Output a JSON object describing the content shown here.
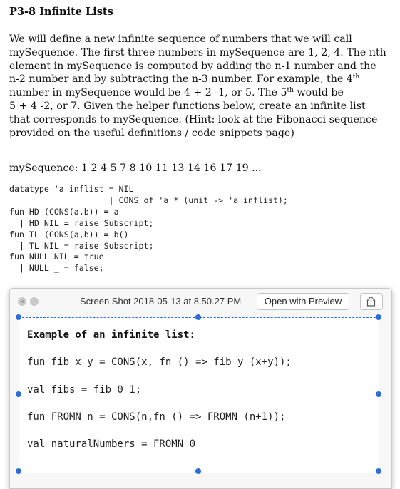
{
  "document": {
    "heading": "P3-8  Infinite Lists",
    "paragraph_lines": [
      "We will define a new infinite sequence of numbers that we will call",
      "mySequence. The first three numbers in mySequence are 1, 2, 4. The nth",
      "element in mySequence is computed by adding the n-1 number and the",
      "n-2 number and by subtracting the n-3 number.  For example, the 4",
      "number in mySequence would be 4 + 2 -1, or 5.  The 5",
      "5 + 4 -2, or 7. Given the helper functions below, create an infinite list",
      "that corresponds to mySequence. (Hint: look at the Fibonacci sequence",
      "provided on the useful definitions / code snippets page)"
    ],
    "sup_th": "th",
    "line5_tail": " would be",
    "sequence": "mySequence: 1 2 4 5 7 8 10 11 13 14 16 17 19 ...",
    "code_lines": [
      "datatype 'a inflist = NIL",
      "                    | CONS of 'a * (unit -> 'a inflist);",
      "fun HD (CONS(a,b)) = a",
      "  | HD NIL = raise Subscript;",
      "fun TL (CONS(a,b)) = b()",
      "  | TL NIL = raise Subscript;",
      "fun NULL NIL = true",
      "  | NULL _ = false;"
    ]
  },
  "popup": {
    "title": "Screen Shot 2018-05-13 at 8.50.27 PM",
    "open_button": "Open with Preview",
    "share_icon": "share-icon",
    "close_glyph": "×",
    "snippet_title": "Example of an infinite list:",
    "snippet_lines": [
      "fun fib x y = CONS(x, fn () => fib y (x+y));",
      "val fibs = fib 0 1;",
      "fun FROMN n = CONS(n,fn () => FROMN (n+1));",
      "val naturalNumbers = FROMN 0"
    ]
  },
  "colors": {
    "selection": "#2a6ed6",
    "popup_bg": "#f7f7f7"
  }
}
